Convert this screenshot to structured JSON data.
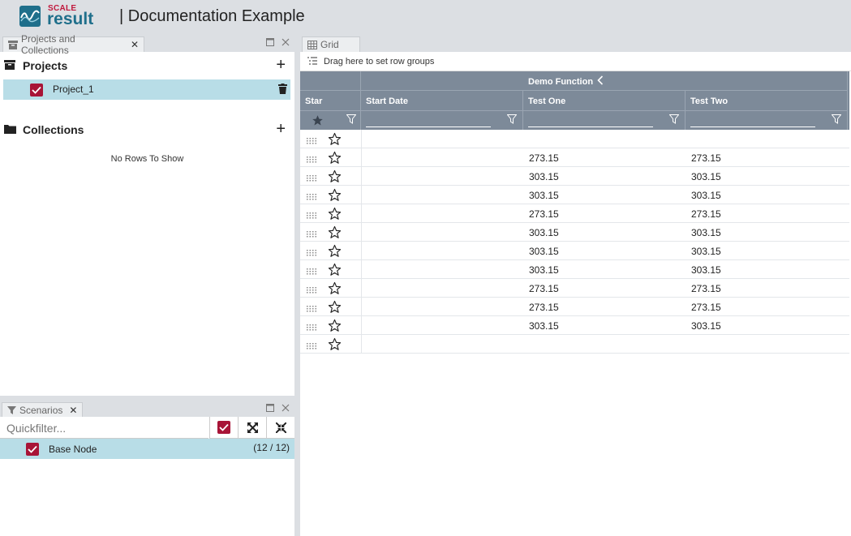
{
  "header": {
    "brand_top": "SCALE",
    "brand_bottom": "result",
    "title": "| Documentation Example"
  },
  "left_panel": {
    "tab_label": "Projects and Collections",
    "projects": {
      "heading": "Projects",
      "items": [
        {
          "name": "Project_1",
          "checked": true
        }
      ]
    },
    "collections": {
      "heading": "Collections",
      "empty_text": "No Rows To Show"
    }
  },
  "scenarios_panel": {
    "tab_label": "Scenarios",
    "quickfilter_placeholder": "Quickfilter...",
    "base_node": {
      "name": "Base Node",
      "count": "(12 / 12)",
      "checked": true
    }
  },
  "grid_panel": {
    "tab_label": "Grid",
    "row_group_hint": "Drag here to set row groups",
    "group_header": "Demo Function",
    "columns": {
      "star": "Star",
      "start_date": "Start Date",
      "test_one": "Test One",
      "test_two": "Test Two"
    },
    "rows": [
      {
        "test_one": "",
        "test_two": ""
      },
      {
        "test_one": "273.15",
        "test_two": "273.15"
      },
      {
        "test_one": "303.15",
        "test_two": "303.15"
      },
      {
        "test_one": "303.15",
        "test_two": "303.15"
      },
      {
        "test_one": "273.15",
        "test_two": "273.15"
      },
      {
        "test_one": "303.15",
        "test_two": "303.15"
      },
      {
        "test_one": "303.15",
        "test_two": "303.15"
      },
      {
        "test_one": "303.15",
        "test_two": "303.15"
      },
      {
        "test_one": "273.15",
        "test_two": "273.15"
      },
      {
        "test_one": "273.15",
        "test_two": "273.15"
      },
      {
        "test_one": "303.15",
        "test_two": "303.15"
      },
      {
        "test_one": "",
        "test_two": ""
      }
    ]
  },
  "colors": {
    "accent": "#a81437",
    "brand": "#1f6f8b",
    "selection": "#b8dde7",
    "grid_header": "#7d8a99",
    "chrome": "#dcdfe3"
  }
}
